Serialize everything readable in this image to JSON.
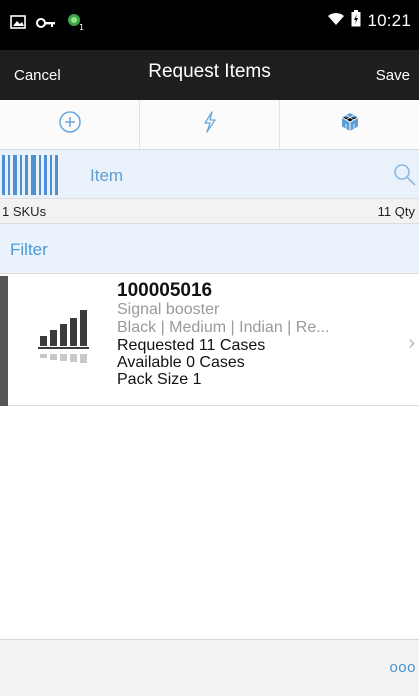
{
  "status_bar": {
    "time": "10:21",
    "left_icons": [
      "image-icon",
      "key-icon",
      "android-badge-icon"
    ],
    "right_icons": [
      "wifi-icon",
      "battery-icon"
    ]
  },
  "action_bar": {
    "cancel_label": "Cancel",
    "title": "Request Items",
    "save_label": "Save"
  },
  "toolbar": {
    "buttons": [
      {
        "icon": "add-circle-icon"
      },
      {
        "icon": "lightning-icon"
      },
      {
        "icon": "cube-icon"
      }
    ]
  },
  "scan": {
    "label": "Item",
    "icon": "barcode-icon",
    "search_icon": "search-icon"
  },
  "summary": {
    "skus": "1 SKUs",
    "qty": "11 Qty"
  },
  "filter": {
    "label": "Filter"
  },
  "items": [
    {
      "id": "100005016",
      "description": "Signal booster",
      "attributes": "Black | Medium | Indian | Re...",
      "requested": "Requested 11 Cases",
      "available": "Available 0 Cases",
      "pack_size": "Pack Size 1",
      "thumbnail_icon": "signal-bars-icon"
    }
  ],
  "footer": {
    "more_label": "ooo"
  },
  "colors": {
    "accent": "#4d98d5",
    "action_bar": "#1e1e1e",
    "status_bar": "#000000"
  }
}
